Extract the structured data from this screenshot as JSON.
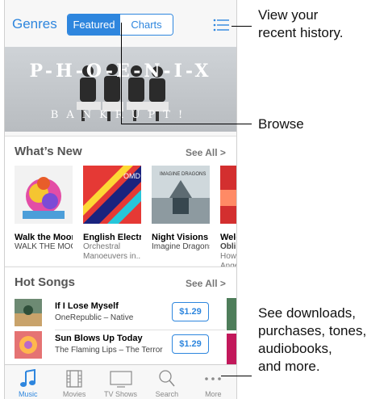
{
  "nav": {
    "genres_label": "Genres",
    "segments": [
      "Featured",
      "Charts"
    ],
    "active_segment": "Featured"
  },
  "banner": {
    "title": "P-H-O-E-N-I-X",
    "subtitle": "BANKRUPT!"
  },
  "whats_new": {
    "title": "What’s New",
    "see_all": "See All >",
    "albums": [
      {
        "title": "Walk the Moon",
        "line1": "WALK THE MOON",
        "line2": ""
      },
      {
        "title": "English Electric",
        "line1": "Orchestral",
        "line2": "Manoeuvers in..."
      },
      {
        "title": "Night Visions",
        "line1": "Imagine Dragons",
        "line2": ""
      },
      {
        "title": "Welc",
        "line1": "Obli",
        "line2": "How",
        "line3": "Ange"
      }
    ]
  },
  "hot_songs": {
    "title": "Hot Songs",
    "see_all": "See All >",
    "songs": [
      {
        "title": "If I Lose Myself",
        "artist": "OneRepublic – Native",
        "price": "$1.29"
      },
      {
        "title": "Sun Blows Up Today",
        "artist": "The Flaming Lips – The Terror",
        "price": "$1.29"
      }
    ]
  },
  "tabbar": {
    "tabs": [
      {
        "label": "Music",
        "icon": "music-note-icon",
        "active": true
      },
      {
        "label": "Movies",
        "icon": "film-icon",
        "active": false
      },
      {
        "label": "TV Shows",
        "icon": "tv-icon",
        "active": false
      },
      {
        "label": "Search",
        "icon": "search-icon",
        "active": false
      },
      {
        "label": "More",
        "icon": "more-icon",
        "active": false
      }
    ]
  },
  "callouts": {
    "history_line1": "View your",
    "history_line2": "recent history.",
    "browse": "Browse",
    "downloads_line1": "See downloads,",
    "downloads_line2": "purchases, tones,",
    "downloads_line3": "audiobooks,",
    "downloads_line4": "and more."
  },
  "colors": {
    "accent": "#2e86de"
  }
}
